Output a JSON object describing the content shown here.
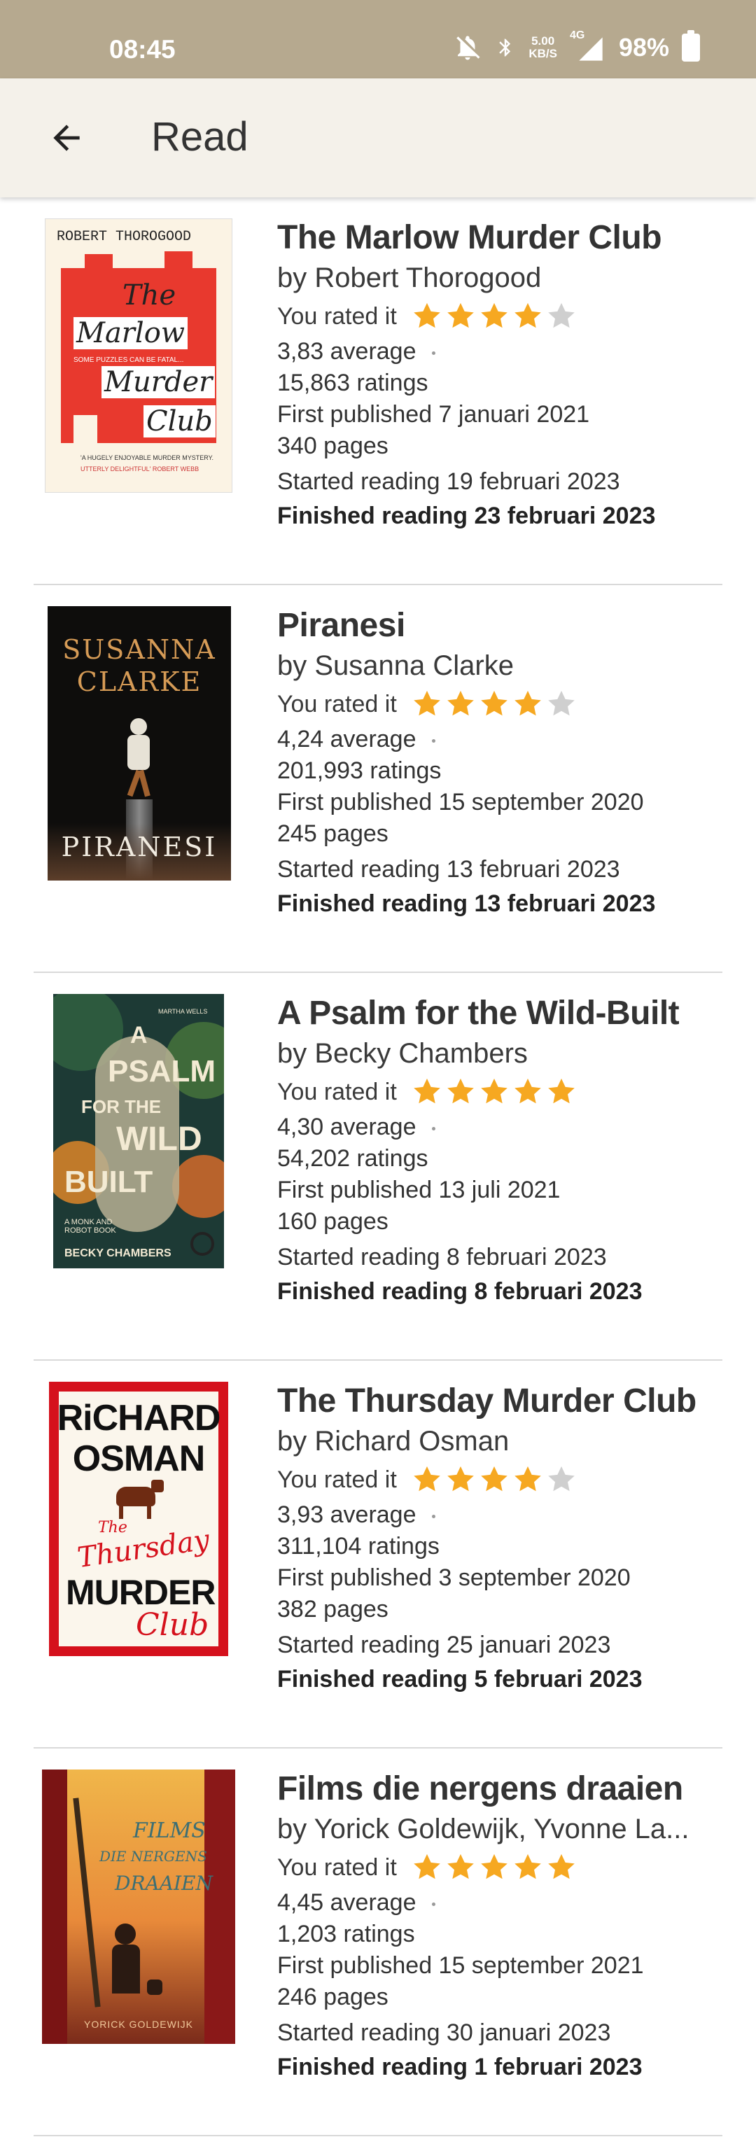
{
  "status_bar": {
    "time": "08:45",
    "net_speed_top": "5.00",
    "net_speed_bottom": "KB/S",
    "network": "4G",
    "battery": "98%"
  },
  "app_bar": {
    "back_icon": "arrow-left-icon",
    "title": "Read"
  },
  "colors": {
    "status_bar": "#b6a98f",
    "app_bar": "#f4f1ea",
    "star_filled": "#f6a821",
    "star_empty": "#cfcfcf"
  },
  "books": [
    {
      "title": "The Marlow Murder Club",
      "author": "by Robert Thorogood",
      "rated_label": "You rated it",
      "rating": 4,
      "average": "3,83 average",
      "ratings": "15,863 ratings",
      "first_published": "First published 7 januari 2021",
      "pages": "340 pages",
      "started": "Started reading 19 februari 2023",
      "finished": "Finished reading 23 februari 2023",
      "cover": {
        "top": "ROBERT THOROGOOD",
        "line1": "The",
        "line2": "Marlow",
        "line3": "Murder",
        "line4": "Club",
        "tag": "SOME PUZZLES CAN BE FATAL...",
        "blurb1": "'A HUGELY ENJOYABLE MURDER MYSTERY.",
        "blurb2": "UTTERLY DELIGHTFUL' ROBERT WEBB"
      }
    },
    {
      "title": "Piranesi",
      "author": "by Susanna Clarke",
      "rated_label": "You rated it",
      "rating": 4,
      "average": "4,24 average",
      "ratings": "201,993 ratings",
      "first_published": "First published 15 september 2020",
      "pages": "245 pages",
      "started": "Started reading 13 februari 2023",
      "finished": "Finished reading 13 februari 2023",
      "cover": {
        "line1": "SUSANNA",
        "line2": "CLARKE",
        "line3": "PIRANESI"
      }
    },
    {
      "title": "A Psalm for the Wild-Built",
      "author": "by Becky Chambers",
      "rated_label": "You rated it",
      "rating": 5,
      "average": "4,30 average",
      "ratings": "54,202 ratings",
      "first_published": "First published 13 juli 2021",
      "pages": "160 pages",
      "started": "Started reading 8 februari 2023",
      "finished": "Finished reading 8 februari 2023",
      "cover": {
        "line1": "A",
        "line2": "PSALM",
        "line3": "FOR THE",
        "line4": "WILD",
        "line5": "BUILT",
        "tag": "A MONK AND ROBOT BOOK",
        "author": "BECKY CHAMBERS",
        "quote": "MARTHA WELLS"
      }
    },
    {
      "title": "The Thursday Murder Club",
      "author": "by Richard Osman",
      "rated_label": "You rated it",
      "rating": 4,
      "average": "3,93 average",
      "ratings": "311,104 ratings",
      "first_published": "First published 3 september 2020",
      "pages": "382 pages",
      "started": "Started reading 25 januari 2023",
      "finished": "Finished reading 5 februari 2023",
      "cover": {
        "line1": "RiCHARD",
        "line2": "OSMAN",
        "line3": "The",
        "line4": "Thursday",
        "line5": "MURDER",
        "line6": "Club"
      }
    },
    {
      "title": "Films die nergens draaien",
      "author": "by Yorick Goldewijk, Yvonne La...",
      "rated_label": "You rated it",
      "rating": 5,
      "average": "4,45 average",
      "ratings": "1,203 ratings",
      "first_published": "First published 15 september 2021",
      "pages": "246 pages",
      "started": "Started reading 30 januari 2023",
      "finished": "Finished reading 1 februari 2023",
      "cover": {
        "line1": "FILMS",
        "line2": "DIE NERGENS",
        "line3": "DRAAIEN",
        "author": "YORICK GOLDEWIJK"
      }
    }
  ]
}
